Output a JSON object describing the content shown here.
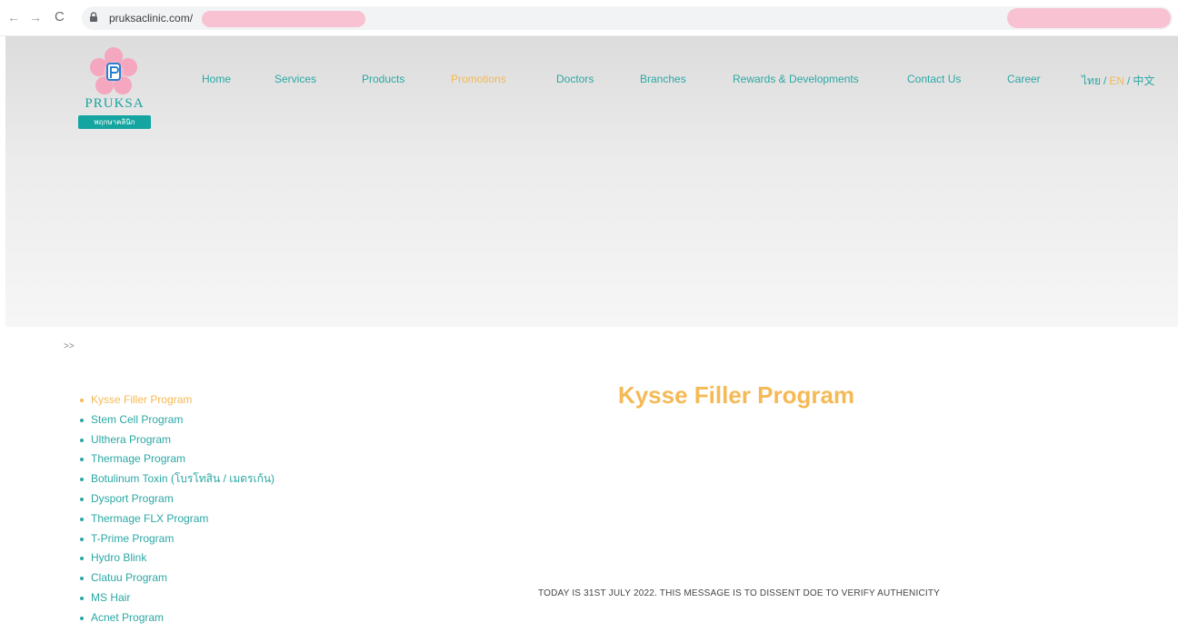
{
  "browser": {
    "back_icon": "back-arrow-icon",
    "forward_icon": "forward-arrow-icon",
    "reload_icon": "reload-icon",
    "back_glyph": "←",
    "forward_glyph": "→",
    "reload_glyph": "C",
    "url": "pruksaclinic.com/",
    "redaction_color": "#f8c2d2"
  },
  "logo": {
    "word": "PRUKSA",
    "tag": "พฤกษาคลินิก",
    "brand_color": "#1aa3a0",
    "petal_color": "#f4a7be"
  },
  "nav": {
    "items": [
      {
        "label": "Home",
        "active": false
      },
      {
        "label": "Services",
        "active": false
      },
      {
        "label": "Products",
        "active": false
      },
      {
        "label": "Promotions",
        "active": true
      },
      {
        "label": "Doctors",
        "active": false
      },
      {
        "label": "Branches",
        "active": false
      },
      {
        "label": "Rewards & Developments",
        "active": false
      },
      {
        "label": "Contact Us",
        "active": false
      },
      {
        "label": "Career",
        "active": false
      }
    ],
    "languages": [
      {
        "label": "ไทย",
        "active": false
      },
      {
        "label": "EN",
        "active": true
      },
      {
        "label": "中文",
        "active": false
      }
    ],
    "link_color": "#2aa8a4",
    "active_color": "#f5b955"
  },
  "breadcrumb": ">>",
  "sidebar": {
    "items": [
      {
        "label": "Kysse Filler Program",
        "active": true
      },
      {
        "label": "Stem Cell Program",
        "active": false
      },
      {
        "label": "Ulthera Program",
        "active": false
      },
      {
        "label": "Thermage Program",
        "active": false
      },
      {
        "label": "Botulinum Toxin (โบรโทสิน / เมดรเก้น)",
        "active": false
      },
      {
        "label": "Dysport Program",
        "active": false
      },
      {
        "label": "Thermage FLX Program",
        "active": false
      },
      {
        "label": "T-Prime Program",
        "active": false
      },
      {
        "label": "Hydro Blink",
        "active": false
      },
      {
        "label": "Clatuu Program",
        "active": false
      },
      {
        "label": "MS Hair",
        "active": false
      },
      {
        "label": "Acnet Program",
        "active": false
      }
    ]
  },
  "main": {
    "title": "Kysse Filler Program",
    "notice": "TODAY IS 31ST JULY 2022. THIS MESSAGE IS TO DISSENT DOE TO VERIFY AUTHENICITY"
  }
}
